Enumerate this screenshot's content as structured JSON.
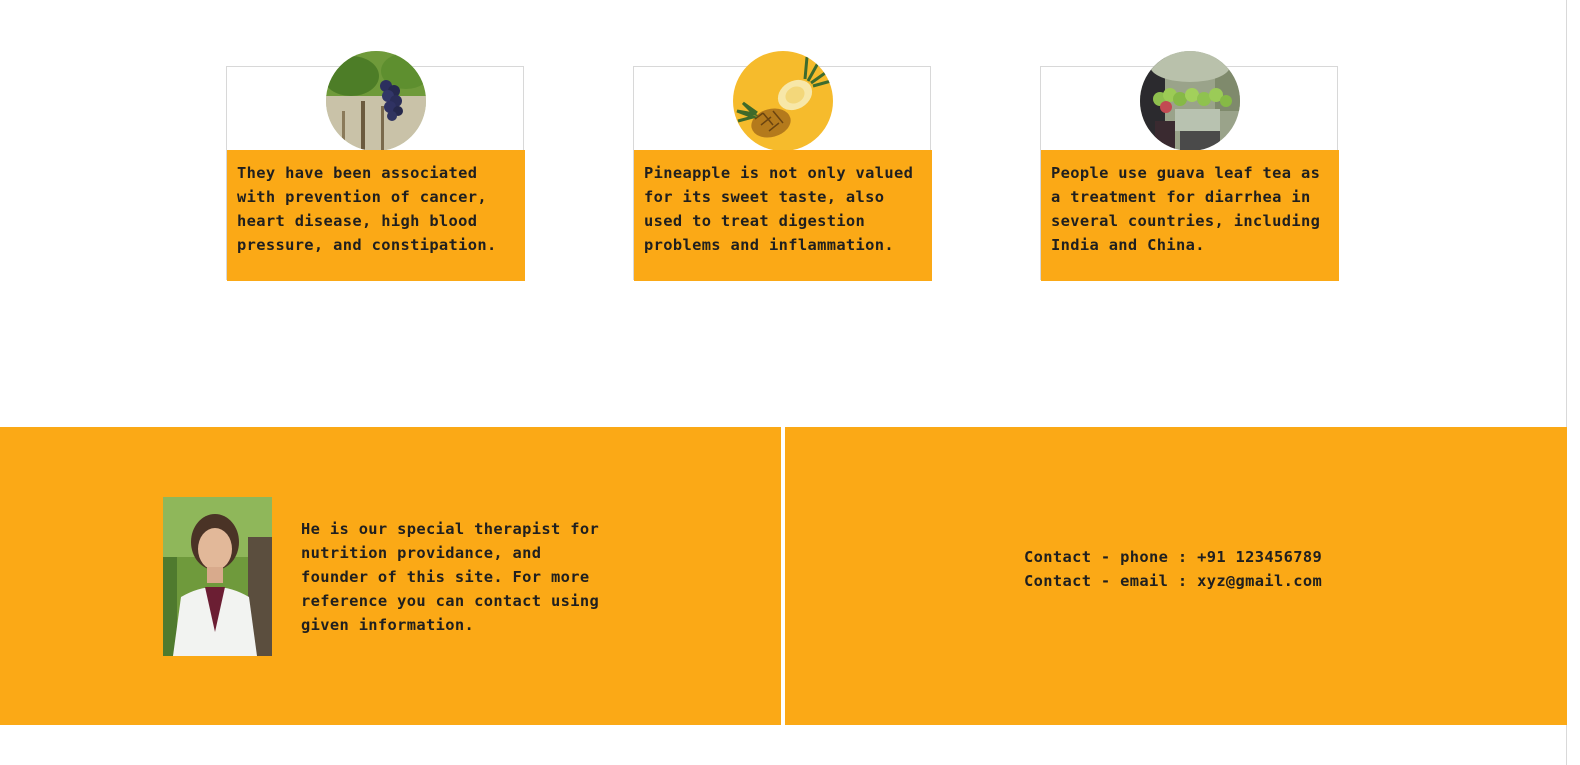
{
  "colors": {
    "accent": "#fba916",
    "text": "#1f1f1f",
    "card_border": "#d8d8d8"
  },
  "cards": [
    {
      "image": "grapes-image",
      "text": "They have been associated\nwith prevention of cancer,\nheart disease, high blood\npressure, and constipation."
    },
    {
      "image": "pineapple-image",
      "text": "Pineapple is not only valued\nfor its sweet taste, also\nused to treat digestion\nproblems and inflammation."
    },
    {
      "image": "guava-image",
      "text": "People use guava leaf tea as\na treatment for diarrhea in\nseveral countries, including\nIndia and China."
    }
  ],
  "footer": {
    "therapist": {
      "photo": "therapist-photo",
      "bio": "He is our special therapist for\nnutrition providance, and\nfounder of this site. For more\nreference you can contact using\ngiven information."
    },
    "contact": {
      "phone": "Contact - phone : +91 123456789",
      "email": "Contact - email : xyz@gmail.com"
    }
  }
}
